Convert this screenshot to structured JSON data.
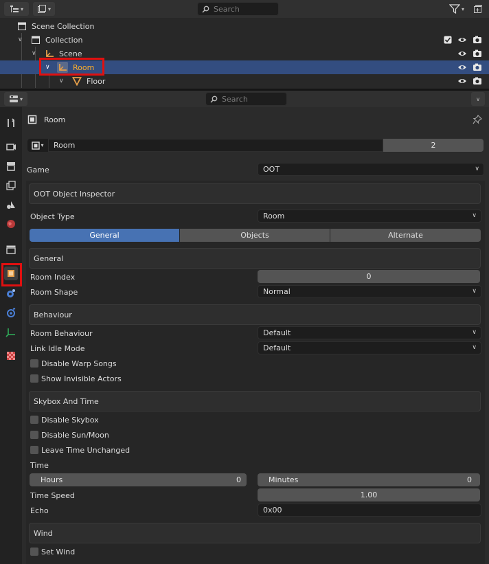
{
  "outliner": {
    "search_placeholder": "Search",
    "rows": {
      "scene_collection": "Scene Collection",
      "collection": "Collection",
      "scene": "Scene",
      "room": "Room",
      "floor": "Floor"
    }
  },
  "properties": {
    "search_placeholder": "Search",
    "object_name_title": "Room",
    "datablock_name": "Room",
    "user_count": "2",
    "game_label": "Game",
    "game_value": "OOT",
    "inspector_title": "OOT Object Inspector",
    "object_type_label": "Object Type",
    "object_type_value": "Room",
    "tabs": [
      "General",
      "Objects",
      "Alternate"
    ],
    "general_panel": "General",
    "room_index_label": "Room Index",
    "room_index_value": "0",
    "room_shape_label": "Room Shape",
    "room_shape_value": "Normal",
    "behaviour_panel": "Behaviour",
    "room_behaviour_label": "Room Behaviour",
    "room_behaviour_value": "Default",
    "link_idle_label": "Link Idle Mode",
    "link_idle_value": "Default",
    "disable_warp_songs": "Disable Warp Songs",
    "show_invisible_actors": "Show Invisible Actors",
    "skybox_panel": "Skybox And Time",
    "disable_skybox": "Disable Skybox",
    "disable_sun_moon": "Disable Sun/Moon",
    "leave_time_unchanged": "Leave Time Unchanged",
    "time_label": "Time",
    "hours_label": "Hours",
    "hours_value": "0",
    "minutes_label": "Minutes",
    "minutes_value": "0",
    "time_speed_label": "Time Speed",
    "time_speed_value": "1.00",
    "echo_label": "Echo",
    "echo_value": "0x00",
    "wind_panel": "Wind",
    "set_wind": "Set Wind"
  },
  "colors": {
    "selection": "#334d80",
    "accent_tab": "#4772b3",
    "highlight_box": "#e01010",
    "object_orange": "#e8a04a"
  }
}
